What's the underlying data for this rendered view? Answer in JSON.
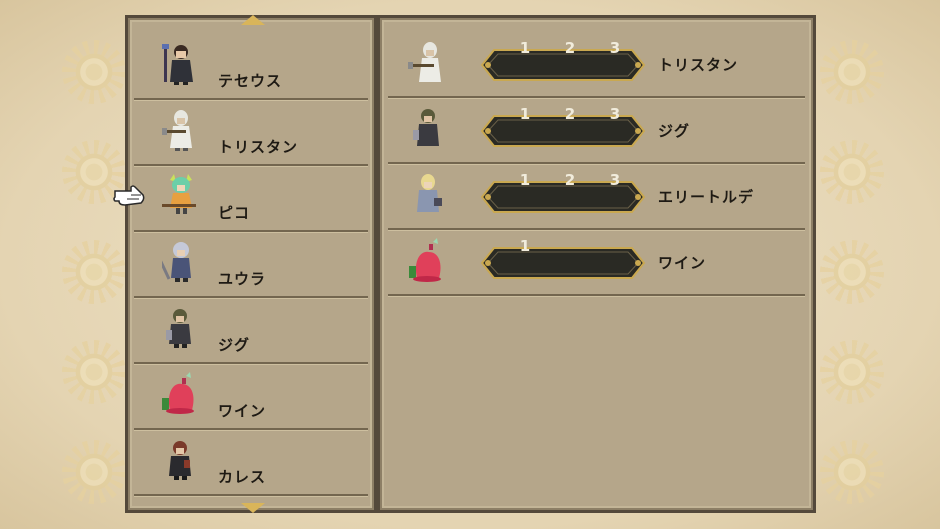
{
  "party_list": {
    "members": [
      {
        "name": "テセウス",
        "icon": "cloaked-mage-sprite"
      },
      {
        "name": "トリスタン",
        "icon": "white-robed-lancer-sprite"
      },
      {
        "name": "ピコ",
        "icon": "green-haired-witch-sprite"
      },
      {
        "name": "ユウラ",
        "icon": "silver-haired-swordsman-sprite"
      },
      {
        "name": "ジグ",
        "icon": "dark-armored-knight-sprite"
      },
      {
        "name": "ワイン",
        "icon": "red-slime-sprite"
      },
      {
        "name": "カレス",
        "icon": "brown-haired-rogue-sprite"
      }
    ],
    "selected_index": 2
  },
  "relations": {
    "rows": [
      {
        "name": "トリスタン",
        "levels": [
          "1",
          "2",
          "3"
        ],
        "icon": "white-robed-lancer-sprite"
      },
      {
        "name": "ジグ",
        "levels": [
          "1",
          "2",
          "3"
        ],
        "icon": "dark-armored-knight-sprite"
      },
      {
        "name": "エリートルデ",
        "levels": [
          "1",
          "2",
          "3"
        ],
        "icon": "blonde-knight-sprite"
      },
      {
        "name": "ワイン",
        "levels": [
          "1"
        ],
        "icon": "red-slime-sprite"
      }
    ]
  },
  "colors": {
    "panel": "#b5a68a",
    "frame": "#54493b",
    "plate": "#2a2a24",
    "gold": "#d9b55a"
  }
}
